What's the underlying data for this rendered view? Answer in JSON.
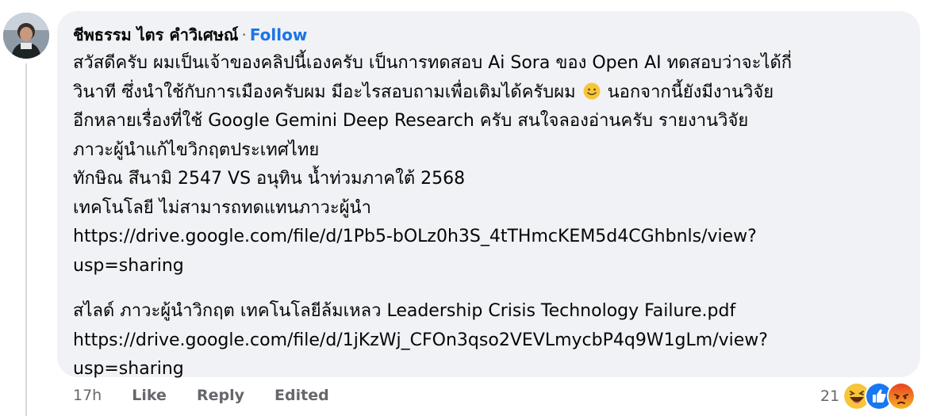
{
  "comment": {
    "author": "ชีพธรรม ไตร คำวิเศษณ์",
    "separator": "·",
    "follow_label": "Follow",
    "lines_1": [
      "สวัสดีครับ ผมเป็นเจ้าของคลิปนี้เองครับ เป็นการทดสอบ Ai Sora ของ Open AI ทดสอบว่าจะได้กี่",
      "วินาที ซึ่งนำใช้กับการเมืองครับผม มีอะไรสอบถามเพื่อเติมได้ครับผม",
      "นอกจากนี้ยังมีงานวิจัย",
      "อีกหลายเรื่องที่ใช้ Google Gemini Deep Research ครับ สนใจลองอ่านครับ รายงานวิจัย",
      "ภาวะผู้นำแก้ไขวิกฤตประเทศไทย",
      "ทักษิณ สึนามิ 2547 VS อนุทิน น้ำท่วมภาคใต้ 2568",
      "เทคโนโลยี ไม่สามารถทดแทนภาวะผู้นำ",
      "https://drive.google.com/file/d/1Pb5-bOLz0h3S_4tTHmcKEM5d4CGhbnls/view?",
      "usp=sharing"
    ],
    "lines_2": [
      "สไลด์ ภาวะผู้นำวิกฤต เทคโนโลยีล้มเหลว Leadership Crisis Technology Failure.pdf",
      "https://drive.google.com/file/d/1jKzWj_CFOn3qso2VEVLmycbP4q9W1gLm/view?",
      "usp=sharing"
    ],
    "emoji": "smiling-face"
  },
  "actions": {
    "time": "17h",
    "like": "Like",
    "reply": "Reply",
    "edited": "Edited"
  },
  "reactions": {
    "count": "21",
    "icons": [
      "haha",
      "like",
      "angry"
    ]
  },
  "colors": {
    "bubble": "#f0f2f5",
    "follow": "#1b74e4",
    "meta": "#65676b",
    "like_blue": "#1877f2"
  }
}
